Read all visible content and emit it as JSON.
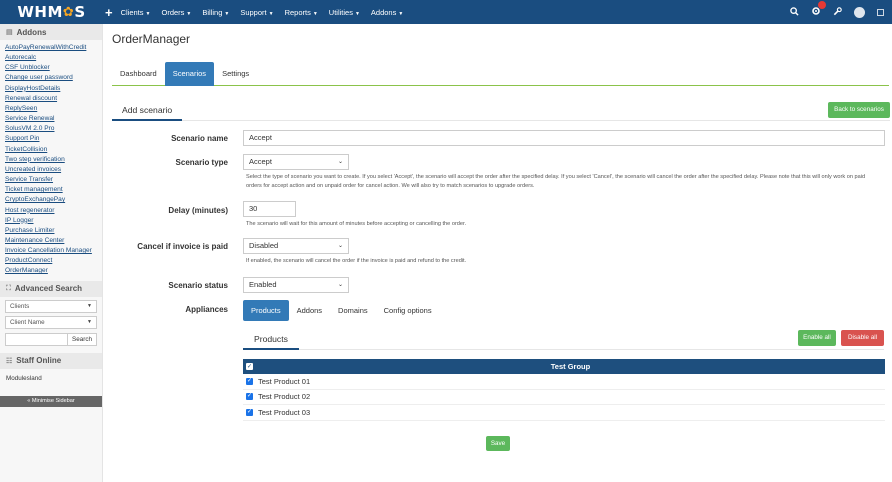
{
  "topbar": {
    "logo_text": "WHM",
    "logo_gear": "✿",
    "logo_suffix": "S",
    "plus": "+",
    "menu": [
      {
        "label": "Clients"
      },
      {
        "label": "Orders"
      },
      {
        "label": "Billing"
      },
      {
        "label": "Support"
      },
      {
        "label": "Reports"
      },
      {
        "label": "Utilities"
      },
      {
        "label": "Addons"
      }
    ],
    "caret": "▼",
    "right_icons": [
      "search-icon",
      "notifications-icon",
      "wrench-icon",
      "user-avatar",
      "window-icon"
    ],
    "notification_badge": "",
    "brand_color": "#1a4d80"
  },
  "sidebar": {
    "addons_title": "Addons",
    "addons": [
      "AutoPayRenewalWithCredit",
      "Autorecalc",
      "CSF Unblocker",
      "Change user password",
      "DisplayHostDetails",
      "Renewal discount",
      "ReplySeen",
      "Service Renewal",
      "SolusVM 2.0 Pro",
      "Support Pin",
      "TicketCollision",
      "Two step verification",
      "Uncreated invoices",
      "Service Transfer",
      "Ticket management",
      "CryptoExchangePay",
      "Host regenerator",
      "IP Logger",
      "Purchase Limiter",
      "Maintenance Center",
      "Invoice Cancellation Manager",
      "ProductConnect",
      "OrderManager"
    ],
    "advanced_search_title": "Advanced Search",
    "search_type": "Clients",
    "search_field": "Client Name",
    "search_button": "Search",
    "staff_title": "Staff Online",
    "staff_name": "Modulesland",
    "minimise": "« Minimise Sidebar"
  },
  "main": {
    "title": "OrderManager",
    "tabs": [
      {
        "label": "Dashboard",
        "active": false
      },
      {
        "label": "Scenarios",
        "active": true
      },
      {
        "label": "Settings",
        "active": false
      }
    ],
    "section_title": "Add scenario",
    "back_button": "Back to scenarios",
    "form": {
      "name_label": "Scenario name",
      "name_value": "Accept",
      "type_label": "Scenario type",
      "type_value": "Accept",
      "type_help": "Select the type of scenario you want to create. If you select 'Accept', the scenario will accept the order after the specified delay. If you select 'Cancel', the scenario will cancel the order after the specified delay. Please note that this will only work on paid orders for accept action and on unpaid order for cancel action. We will also try to match scenarios to upgrade orders.",
      "delay_label": "Delay (minutes)",
      "delay_value": "30",
      "delay_help": "The scenario will wait for this amount of minutes before accepting or cancelling the order.",
      "cancel_paid_label": "Cancel if invoice is paid",
      "cancel_paid_value": "Disabled",
      "cancel_paid_help": "If enabled, the scenario will cancel the order if the invoice is paid and refund to the credit.",
      "status_label": "Scenario status",
      "status_value": "Enabled",
      "appliances_label": "Appliances"
    },
    "appliance_tabs": [
      {
        "label": "Products",
        "active": true
      },
      {
        "label": "Addons",
        "active": false
      },
      {
        "label": "Domains",
        "active": false
      },
      {
        "label": "Config options",
        "active": false
      }
    ],
    "products_title": "Products",
    "enable_all": "Enable all",
    "disable_all": "Disable all",
    "group_header": "Test Group",
    "products": [
      {
        "name": "Test Product 01",
        "checked": true
      },
      {
        "name": "Test Product 02",
        "checked": true
      },
      {
        "name": "Test Product 03",
        "checked": true
      }
    ],
    "save_button": "Save",
    "check_mark": "✓",
    "chevron": "⌄"
  }
}
